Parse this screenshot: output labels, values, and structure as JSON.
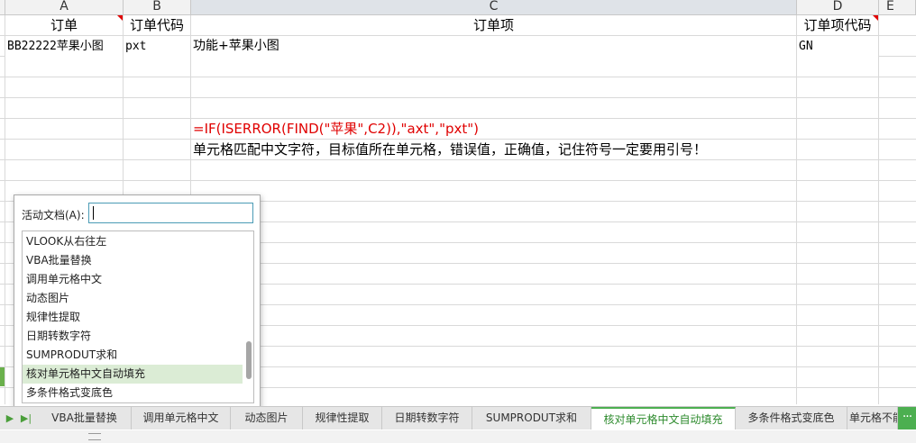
{
  "columns": {
    "a": "A",
    "b": "B",
    "c": "C",
    "d": "D",
    "e": "E"
  },
  "header_row": {
    "a": "订单",
    "b": "订单代码",
    "c": "订单项",
    "d": "订单项代码"
  },
  "row2": {
    "a": "BB22222苹果小图",
    "b": "pxt",
    "c": "功能+苹果小图",
    "d": "GN"
  },
  "formula_text": "=IF(ISERROR(FIND(\"苹果\",C2)),\"axt\",\"pxt\")",
  "note_text": "单元格匹配中文字符，目标值所在单元格，错误值，正确值，记住符号一定要用引号！",
  "popup": {
    "label": "活动文档(A):",
    "input_value": "",
    "items": [
      "VLOOK从右往左",
      "VBA批量替换",
      "调用单元格中文",
      "动态图片",
      "规律性提取",
      "日期转数字符",
      "SUMPRODUT求和",
      "核对单元格中文自动填充",
      "多条件格式变底色"
    ],
    "selected": "核对单元格中文自动填充"
  },
  "tabs": [
    "VBA批量替换",
    "调用单元格中文",
    "动态图片",
    "规律性提取",
    "日期转数字符",
    "SUMPRODUT求和",
    "核对单元格中文自动填充",
    "多条件格式变底色",
    "单元格不能"
  ],
  "active_tab": "核对单元格中文自动填充",
  "colors": {
    "accent": "#4caf50",
    "formula": "#e00000",
    "selection": "#dbecd5"
  }
}
